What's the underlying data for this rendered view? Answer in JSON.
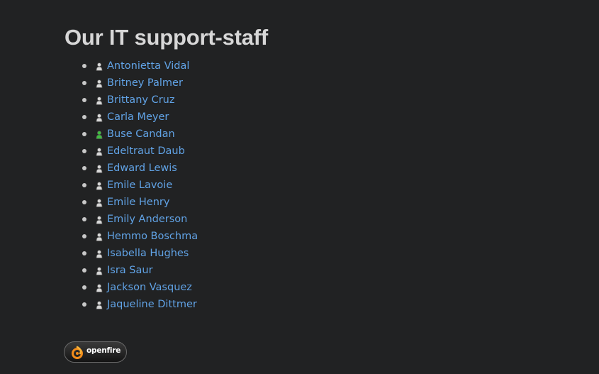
{
  "heading": "Our IT support-staff",
  "staff": [
    {
      "name": "Antonietta Vidal",
      "status": "offline"
    },
    {
      "name": "Britney Palmer",
      "status": "offline"
    },
    {
      "name": "Brittany Cruz",
      "status": "offline"
    },
    {
      "name": "Carla Meyer",
      "status": "offline"
    },
    {
      "name": "Buse Candan",
      "status": "online"
    },
    {
      "name": "Edeltraut Daub",
      "status": "offline"
    },
    {
      "name": "Edward Lewis",
      "status": "offline"
    },
    {
      "name": "Emile Lavoie",
      "status": "offline"
    },
    {
      "name": "Emile Henry",
      "status": "offline"
    },
    {
      "name": "Emily Anderson",
      "status": "offline"
    },
    {
      "name": "Hemmo Boschma",
      "status": "offline"
    },
    {
      "name": "Isabella Hughes",
      "status": "offline"
    },
    {
      "name": "Isra Saur",
      "status": "offline"
    },
    {
      "name": "Jackson Vasquez",
      "status": "offline"
    },
    {
      "name": "Jaqueline Dittmer",
      "status": "offline"
    }
  ],
  "footer": {
    "badge_text": "openfire",
    "badge_icon": "openfire-flame-icon"
  },
  "colors": {
    "background": "#212223",
    "heading": "#d7d7d7",
    "link": "#61a3e6",
    "online": "#3fbf3f",
    "offline": "#d8d8d8"
  }
}
